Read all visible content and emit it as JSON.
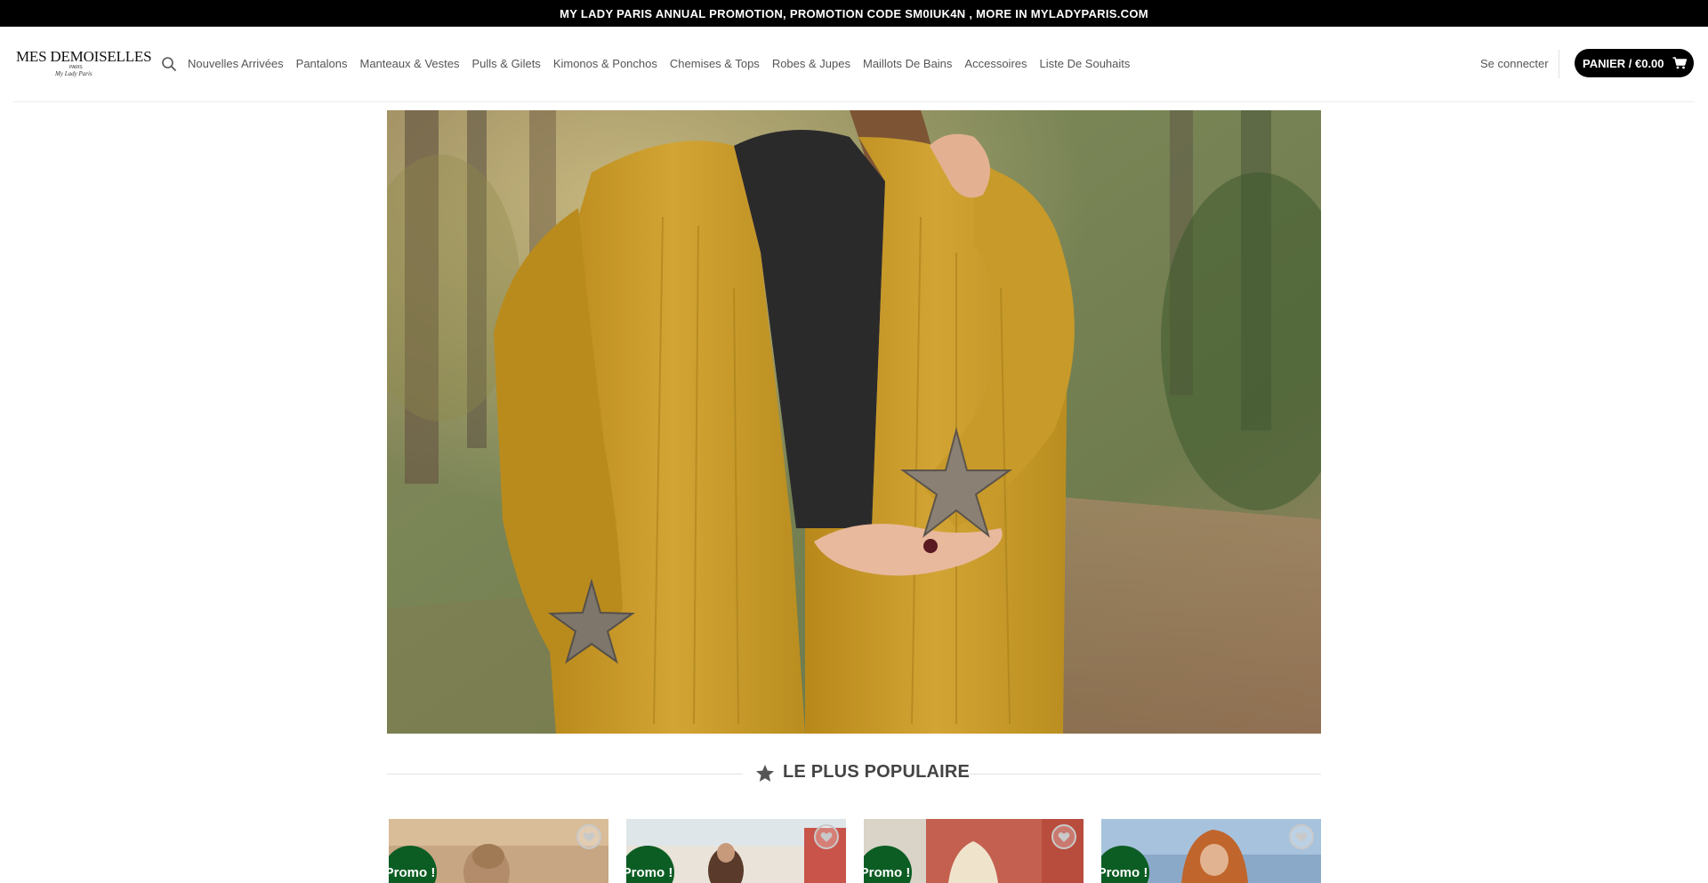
{
  "promo_bar": {
    "text": "MY LADY PARIS ANNUAL PROMOTION, PROMOTION CODE SM0IUK4N , MORE IN MYLADYPARIS.COM"
  },
  "header": {
    "logo": {
      "main": "MES DEMOISELLES",
      "paris": "PARIS",
      "sub": "My Lady Paris"
    },
    "search_icon": "search-icon",
    "nav": [
      "Nouvelles Arrivées",
      "Pantalons",
      "Manteaux & Vestes",
      "Pulls & Gilets",
      "Kimonos & Ponchos",
      "Chemises & Tops",
      "Robes & Jupes",
      "Maillots De Bains",
      "Accessoires",
      "Liste De Souhaits"
    ],
    "login": "Se connecter",
    "cart_label": "PANIER / €0.00",
    "cart_icon": "cart-icon"
  },
  "hero": {
    "icon": "hero-photo"
  },
  "section": {
    "title": "LE PLUS POPULAIRE",
    "icon": "star-icon"
  },
  "products": [
    {
      "badge": "Promo !",
      "wishlist_icon": "heart-icon"
    },
    {
      "badge": "Promo !",
      "wishlist_icon": "heart-icon"
    },
    {
      "badge": "Promo !",
      "wishlist_icon": "heart-icon"
    },
    {
      "badge": "Promo !",
      "wishlist_icon": "heart-icon"
    }
  ],
  "colors": {
    "accent_black": "#000000",
    "promo_green": "#0c5d23",
    "mustard": "#c9991f"
  }
}
